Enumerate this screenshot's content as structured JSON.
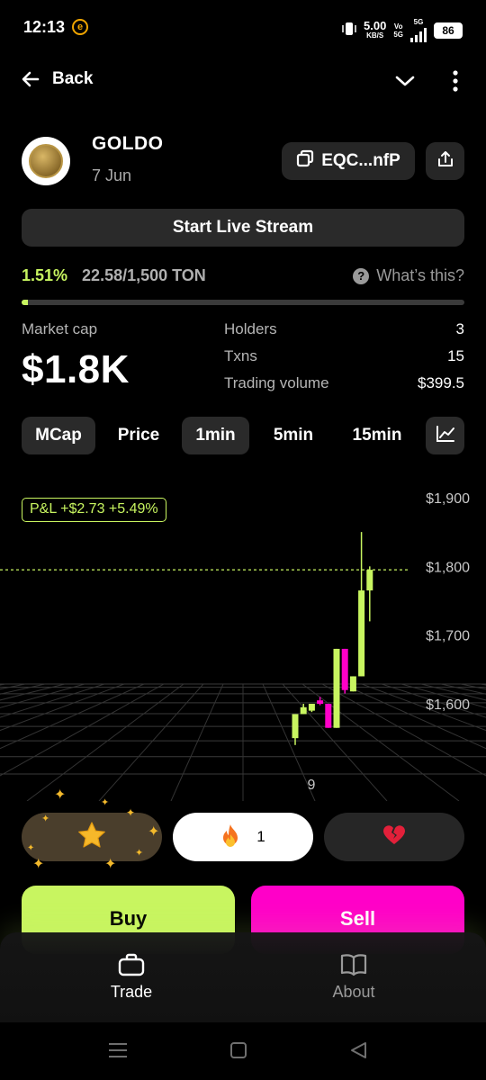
{
  "status_bar": {
    "time": "12:13",
    "carrier_icon": "e",
    "speed_value": "5.00",
    "speed_unit": "KB/S",
    "volte_top": "Vo",
    "volte_bottom": "5G",
    "network": "5G",
    "battery": "86"
  },
  "nav": {
    "back_label": "Back"
  },
  "token": {
    "name": "GOLDO",
    "date": "7 Jun",
    "address": "EQC...nfP"
  },
  "stream_button": "Start Live Stream",
  "progress": {
    "percent_label": "1.51%",
    "amount_label": "22.58/1,500 TON",
    "help_label": "What’s this?",
    "fraction": 0.0151,
    "bar_color": "#c8f560"
  },
  "stats": {
    "market_cap_label": "Market cap",
    "market_cap_value": "$1.8K",
    "rows": [
      {
        "label": "Holders",
        "value": "3"
      },
      {
        "label": "Txns",
        "value": "15"
      },
      {
        "label": "Trading volume",
        "value": "$399.5"
      }
    ]
  },
  "tabs": [
    {
      "label": "MCap",
      "active": true
    },
    {
      "label": "Price",
      "active": false
    },
    {
      "label": "1min",
      "active": true
    },
    {
      "label": "5min",
      "active": false
    },
    {
      "label": "15min",
      "active": false
    }
  ],
  "chart_data": {
    "type": "candlestick",
    "pnl_badge": "P&L +$2.73 +5.49%",
    "y_ticks": [
      "$1,900",
      "$1,800",
      "$1,700",
      "$1,600"
    ],
    "y_range": [
      1550,
      1920
    ],
    "x_tick": "9",
    "current_value": 1795,
    "colors": {
      "up": "#c8f560",
      "down": "#ff00c8",
      "line": "#c8f560"
    },
    "candles": [
      {
        "open": 1550,
        "close": 1585,
        "high": 1585,
        "low": 1540
      },
      {
        "open": 1585,
        "close": 1595,
        "high": 1600,
        "low": 1585
      },
      {
        "open": 1590,
        "close": 1600,
        "high": 1600,
        "low": 1588
      },
      {
        "open": 1605,
        "close": 1600,
        "high": 1610,
        "low": 1598
      },
      {
        "open": 1600,
        "close": 1565,
        "high": 1600,
        "low": 1565
      },
      {
        "open": 1565,
        "close": 1680,
        "high": 1680,
        "low": 1565
      },
      {
        "open": 1680,
        "close": 1620,
        "high": 1680,
        "low": 1615
      },
      {
        "open": 1618,
        "close": 1640,
        "high": 1640,
        "low": 1618
      },
      {
        "open": 1640,
        "close": 1765,
        "high": 1850,
        "low": 1640
      },
      {
        "open": 1765,
        "close": 1795,
        "high": 1800,
        "low": 1720
      }
    ]
  },
  "reactions": {
    "fire_count": "1"
  },
  "actions": {
    "buy_label": "Buy",
    "sell_label": "Sell"
  },
  "bottom_nav": {
    "trade_label": "Trade",
    "about_label": "About"
  }
}
